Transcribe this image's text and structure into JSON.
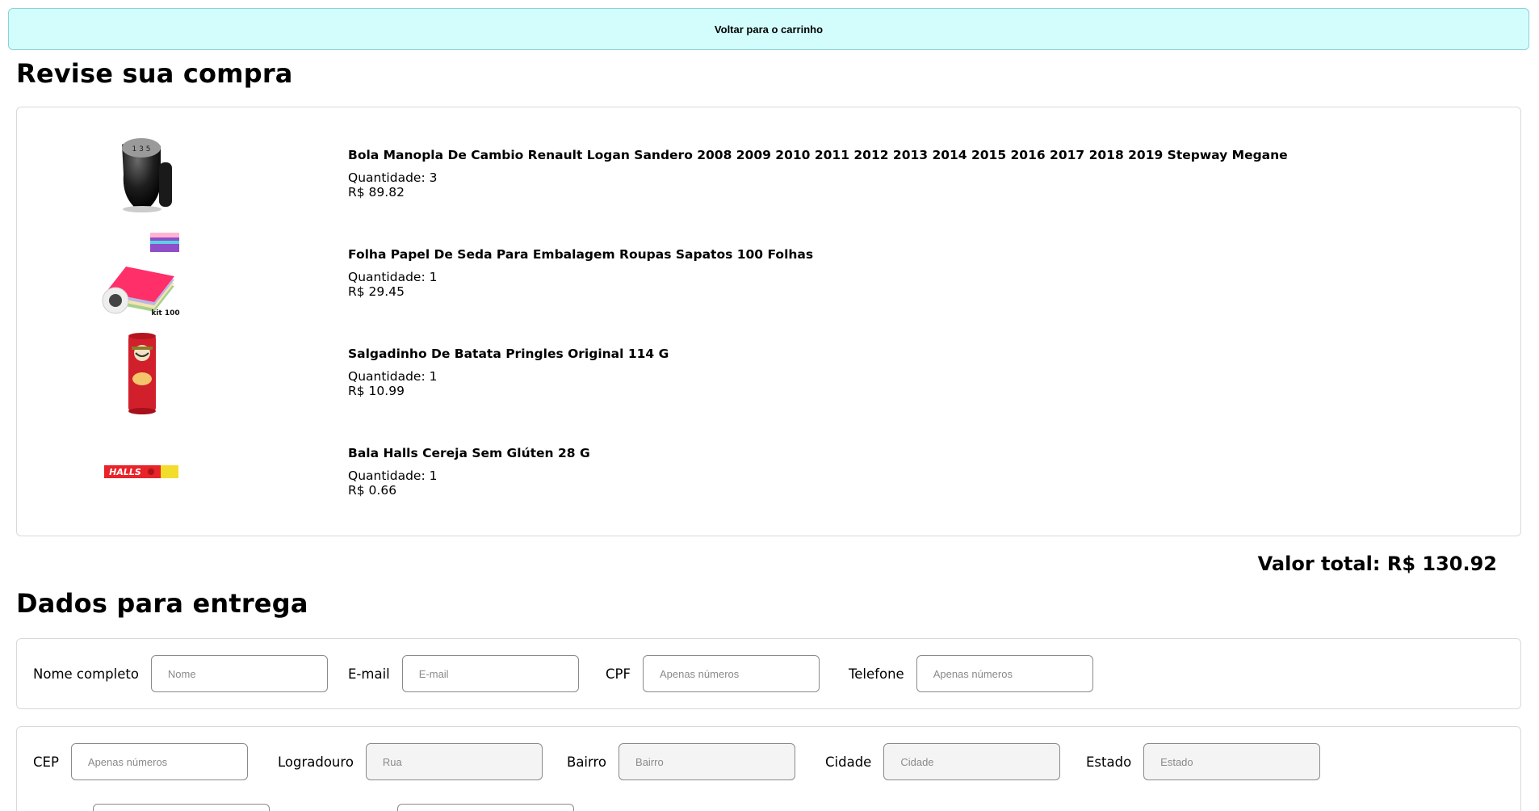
{
  "back_button": {
    "label": "Voltar para o carrinho"
  },
  "review": {
    "title": "Revise sua compra",
    "items": [
      {
        "title": "Bola Manopla De Cambio Renault Logan Sandero 2008 2009 2010 2011 2012 2013 2014 2015 2016 2017 2018 2019 Stepway Megane",
        "quantity": "Quantidade: 3",
        "price": "R$ 89.82",
        "image": "gear-knob"
      },
      {
        "title": "Folha Papel De Seda Para Embalagem Roupas Sapatos 100 Folhas",
        "quantity": "Quantidade: 1",
        "price": "R$ 29.45",
        "image": "tissue-paper",
        "image_text": "kit 100"
      },
      {
        "title": "Salgadinho De Batata Pringles Original 114 G",
        "quantity": "Quantidade: 1",
        "price": "R$ 10.99",
        "image": "pringles-can"
      },
      {
        "title": "Bala Halls Cereja Sem Glúten 28 G",
        "quantity": "Quantidade: 1",
        "price": "R$ 0.66",
        "image": "halls-pack",
        "image_text": "HALLS"
      }
    ],
    "total": "Valor total: R$ 130.92"
  },
  "delivery": {
    "title": "Dados para entrega",
    "row1": [
      {
        "label": "Nome completo",
        "placeholder": "Nome"
      },
      {
        "label": "E-mail",
        "placeholder": "E-mail"
      },
      {
        "label": "CPF",
        "placeholder": "Apenas números"
      },
      {
        "label": "Telefone",
        "placeholder": "Apenas números"
      }
    ],
    "row2": [
      {
        "label": "CEP",
        "placeholder": "Apenas números"
      },
      {
        "label": "Logradouro",
        "placeholder": "Rua"
      },
      {
        "label": "Bairro",
        "placeholder": "Bairro"
      },
      {
        "label": "Cidade",
        "placeholder": "Cidade"
      },
      {
        "label": "Estado",
        "placeholder": "Estado"
      }
    ]
  }
}
